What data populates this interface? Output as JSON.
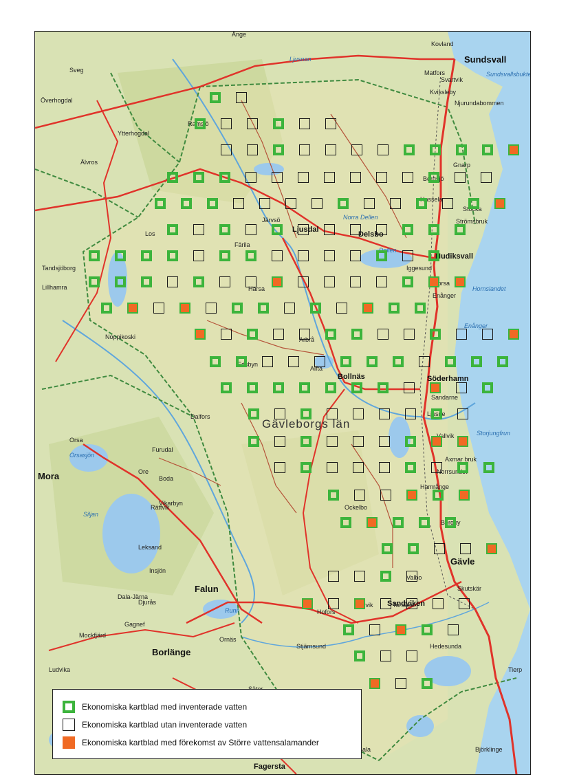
{
  "map": {
    "region_label": "Gävleborgs län",
    "places_major": [
      "Sundsvall",
      "Hudiksvall",
      "Söderhamn",
      "Gävle",
      "Sandviken",
      "Bollnäs",
      "Ljusdal",
      "Delsbo",
      "Mora",
      "Falun",
      "Borlänge"
    ],
    "places_minor": [
      "Orsa",
      "Rättvik",
      "Leksand",
      "Insjön",
      "Säter",
      "Ockelbo",
      "Alfta",
      "Edsbyn",
      "Hofors",
      "Tierp",
      "Skutskär",
      "Matfors",
      "Kvissleby",
      "Arbrå",
      "Järvsö",
      "Storvik",
      "Valbo",
      "Hedesunda",
      "Torsåker",
      "Björklinge",
      "Fagersta",
      "Ånge",
      "Kovland",
      "Svartvik",
      "Njurundabommen",
      "Gnarp",
      "Hassela",
      "Bergsjö",
      "Iggesund",
      "Stocka",
      "Strömsbruk",
      "Forsa",
      "Enånger",
      "Ljusne",
      "Vallvik",
      "Sandarne",
      "Norrsundet",
      "Axmar bruk",
      "Hamrånge",
      "Bergby",
      "Harsa",
      "Färila",
      "Los",
      "Ramsjö",
      "Ytterhogdal",
      "Överhogdal",
      "Sveg",
      "Älvros",
      "Tandsjöborg",
      "Lillhamra",
      "Noppikoski",
      "Dalfors",
      "Furudal",
      "Boda",
      "Vikarbyn",
      "Ore",
      "Dala-Järna",
      "Gagnef",
      "Djurås",
      "Mockfjärd",
      "Ornäs",
      "Stjärnsund",
      "Ludvika",
      "Sala"
    ],
    "water_labels": [
      "Siljan",
      "Ljusnan",
      "Dellen",
      "Runn",
      "Orsasjön",
      "Norra Dellen",
      "Sundsvallsbukten",
      "Enånger",
      "Hornslandet",
      "Storjungfrun"
    ],
    "legend": {
      "inventoried": "Ekonomiska kartblad med inventerade vatten",
      "not_inventoried": "Ekonomiska kartblad utan inventerade vatten",
      "newt_found": "Ekonomiska kartblad med förekomst av Större vattensalamander"
    },
    "colors": {
      "land": "#d9e2b4",
      "forest": "#c9d79a",
      "sea": "#a9d4ef",
      "lake": "#9cc9ec",
      "road": "#e0332a",
      "border": "#3f8a3f",
      "inventoried": "#3cb43c",
      "newt_found": "#f06a24"
    }
  }
}
